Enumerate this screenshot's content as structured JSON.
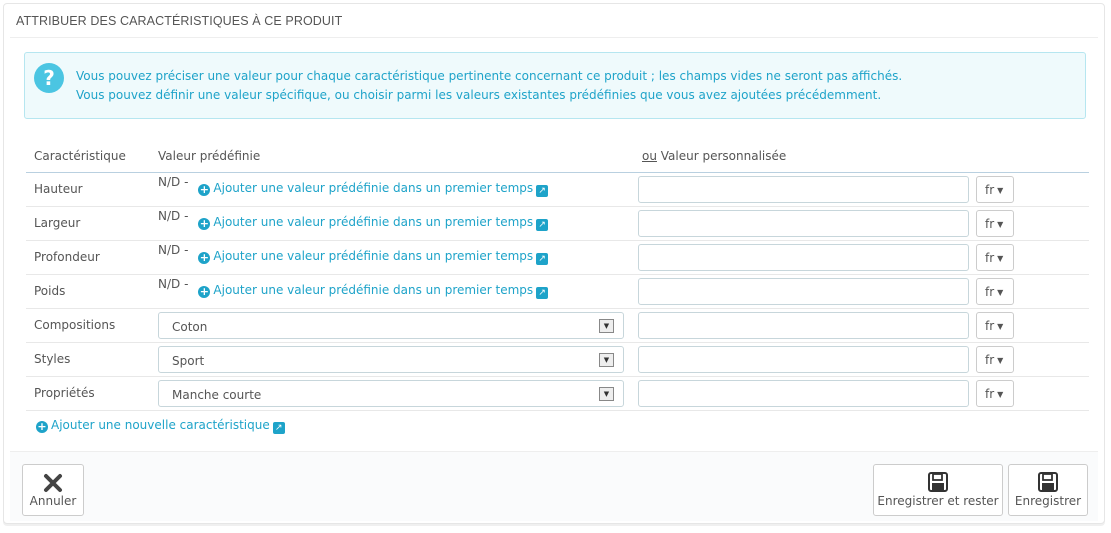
{
  "panel": {
    "title": "ATTRIBUER DES CARACTÉRISTIQUES À CE PRODUIT"
  },
  "alert": {
    "icon": "question-icon",
    "line1": "Vous pouvez préciser une valeur pour chaque caractéristique pertinente concernant ce produit ; les champs vides ne seront pas affichés.",
    "line2": "Vous pouvez définir une valeur spécifique, ou choisir parmi les valeurs existantes prédéfinies que vous avez ajoutées précédemment."
  },
  "table": {
    "headers": {
      "feature": "Caractéristique",
      "predefined": "Valeur prédéfinie",
      "or": "ou",
      "custom": "Valeur personnalisée"
    },
    "nd_label": "N/D -",
    "add_predefined_label": "Ajouter une valeur prédéfinie dans un premier temps",
    "lang": "fr",
    "rows": [
      {
        "name": "Hauteur",
        "type": "none",
        "custom_value": ""
      },
      {
        "name": "Largeur",
        "type": "none",
        "custom_value": ""
      },
      {
        "name": "Profondeur",
        "type": "none",
        "custom_value": ""
      },
      {
        "name": "Poids",
        "type": "none",
        "custom_value": ""
      },
      {
        "name": "Compositions",
        "type": "select",
        "selected": "Coton",
        "custom_value": ""
      },
      {
        "name": "Styles",
        "type": "select",
        "selected": "Sport",
        "custom_value": ""
      },
      {
        "name": "Propriétés",
        "type": "select",
        "selected": "Manche courte",
        "custom_value": ""
      }
    ]
  },
  "add_feature_label": "Ajouter une nouvelle caractéristique",
  "footer": {
    "cancel": "Annuler",
    "save_and_stay": "Enregistrer et rester",
    "save": "Enregistrer"
  },
  "colors": {
    "accent": "#1ea3c9",
    "alert_bg": "#effafc",
    "alert_border": "#b6e6f0"
  }
}
